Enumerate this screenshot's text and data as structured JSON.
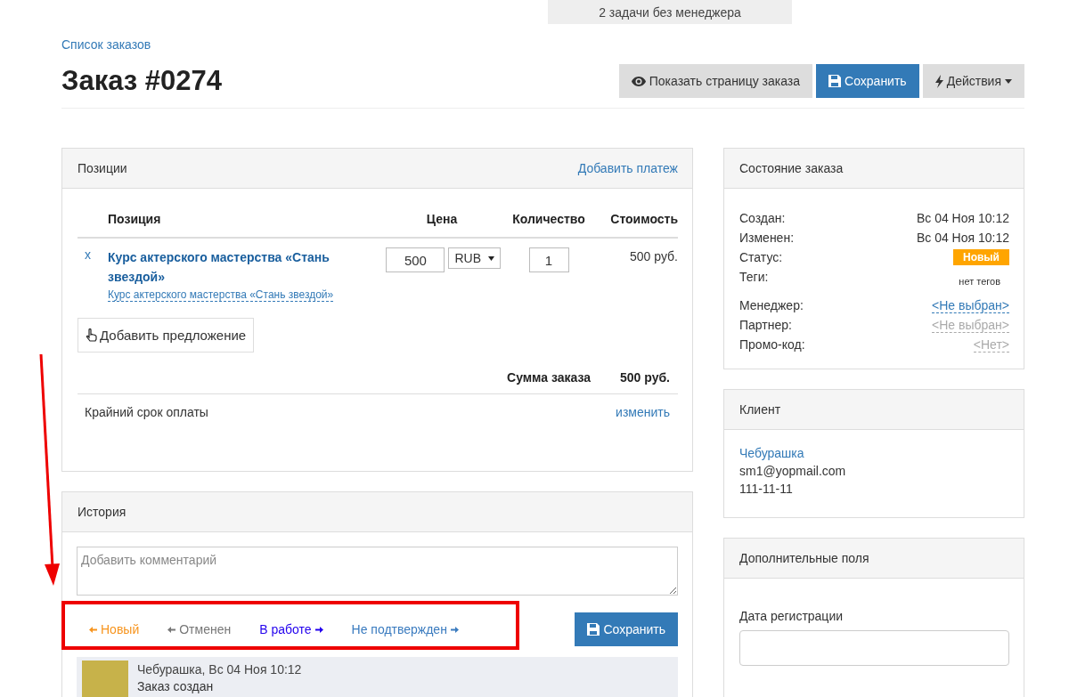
{
  "notice": "2 задачи без менеджера",
  "breadcrumb": "Список заказов",
  "title": "Заказ #0274",
  "header_buttons": [
    {
      "label": "Показать страницу заказа",
      "kind": "view"
    },
    {
      "label": "Сохранить",
      "kind": "save"
    },
    {
      "label": "Действия",
      "kind": "actions"
    }
  ],
  "positions": {
    "title": "Позиции",
    "add_payment": "Добавить платеж",
    "columns": [
      "Позиция",
      "Цена",
      "Количество",
      "Стоимость"
    ],
    "rows": [
      {
        "remove": "x",
        "name": "Курс актерского мастерства «Стань звездой»",
        "offer": "Курс актерского мастерства «Стань звездой»",
        "price": "500",
        "currency": "RUB",
        "quantity": "1",
        "cost": "500 руб."
      }
    ],
    "add_offer": "Добавить предложение",
    "total_label": "Сумма заказа",
    "total": "500 руб.",
    "deadline_label": "Крайний срок оплаты",
    "deadline_action": "изменить"
  },
  "history": {
    "title": "История",
    "comment_placeholder": "Добавить комментарий",
    "transitions": [
      {
        "label": "Новый",
        "kind": "back",
        "color": "#f7941d"
      },
      {
        "label": "Отменен",
        "kind": "back",
        "color": "#777777"
      },
      {
        "label": "В работе",
        "kind": "forward",
        "color": "#2200ee"
      },
      {
        "label": "Не подтвержден",
        "kind": "forward",
        "color": "#3a7bbf"
      }
    ],
    "save": "Сохранить",
    "entries": [
      {
        "author": "Чебурашка",
        "time": ", Вс 04 Ноя 10:12",
        "text": "Заказ создан"
      }
    ]
  },
  "order_state": {
    "title": "Состояние заказа",
    "rows": [
      {
        "label": "Создан:",
        "value": "Вс 04 Ноя 10:12",
        "kind": "text"
      },
      {
        "label": "Изменен:",
        "value": "Вс 04 Ноя 10:12",
        "kind": "text"
      },
      {
        "label": "Статус:",
        "value": "Новый",
        "kind": "badge"
      },
      {
        "label": "Теги:",
        "value": "нет тегов",
        "kind": "small"
      },
      {
        "label": "Менеджер:",
        "value": "<Не выбран>",
        "kind": "link"
      },
      {
        "label": "Партнер:",
        "value": "<Не выбран>",
        "kind": "muted"
      },
      {
        "label": "Промо-код:",
        "value": "<Нет>",
        "kind": "muted"
      }
    ]
  },
  "client": {
    "title": "Клиент",
    "name": "Чебурашка",
    "email": "sm1@yopmail.com",
    "phone": "111-11-11"
  },
  "extra_fields": {
    "title": "Дополнительные поля",
    "fields": [
      {
        "label": "Дата регистрации"
      }
    ]
  }
}
